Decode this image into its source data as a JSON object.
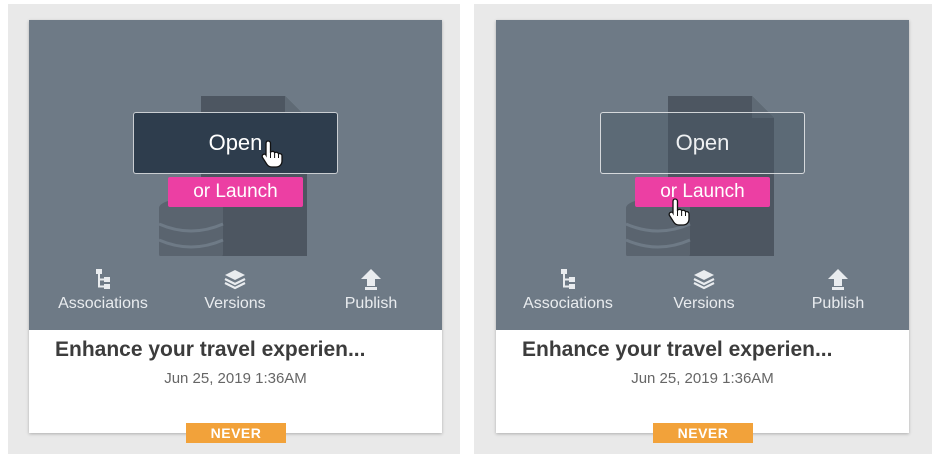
{
  "cards": [
    {
      "title": "Enhance your travel experien...",
      "date": "Jun 25, 2019 1:36AM",
      "open_label": "Open",
      "launch_label": "or Launch",
      "actions": {
        "associations": "Associations",
        "versions": "Versions",
        "publish": "Publish"
      },
      "badge": "NEVER"
    },
    {
      "title": "Enhance your travel experien...",
      "date": "Jun 25, 2019 1:36AM",
      "open_label": "Open",
      "launch_label": "or Launch",
      "actions": {
        "associations": "Associations",
        "versions": "Versions",
        "publish": "Publish"
      },
      "badge": "NEVER"
    }
  ],
  "icons": {
    "document": "document-database-icon",
    "associations": "hierarchy-icon",
    "versions": "layers-icon",
    "publish": "upload-arrow-icon",
    "cursor": "hand-pointer-icon"
  },
  "colors": {
    "card_top": "#6e7a86",
    "launch": "#ec3fa3",
    "badge": "#f2a23a",
    "open_hover": "#2e3d4d"
  }
}
